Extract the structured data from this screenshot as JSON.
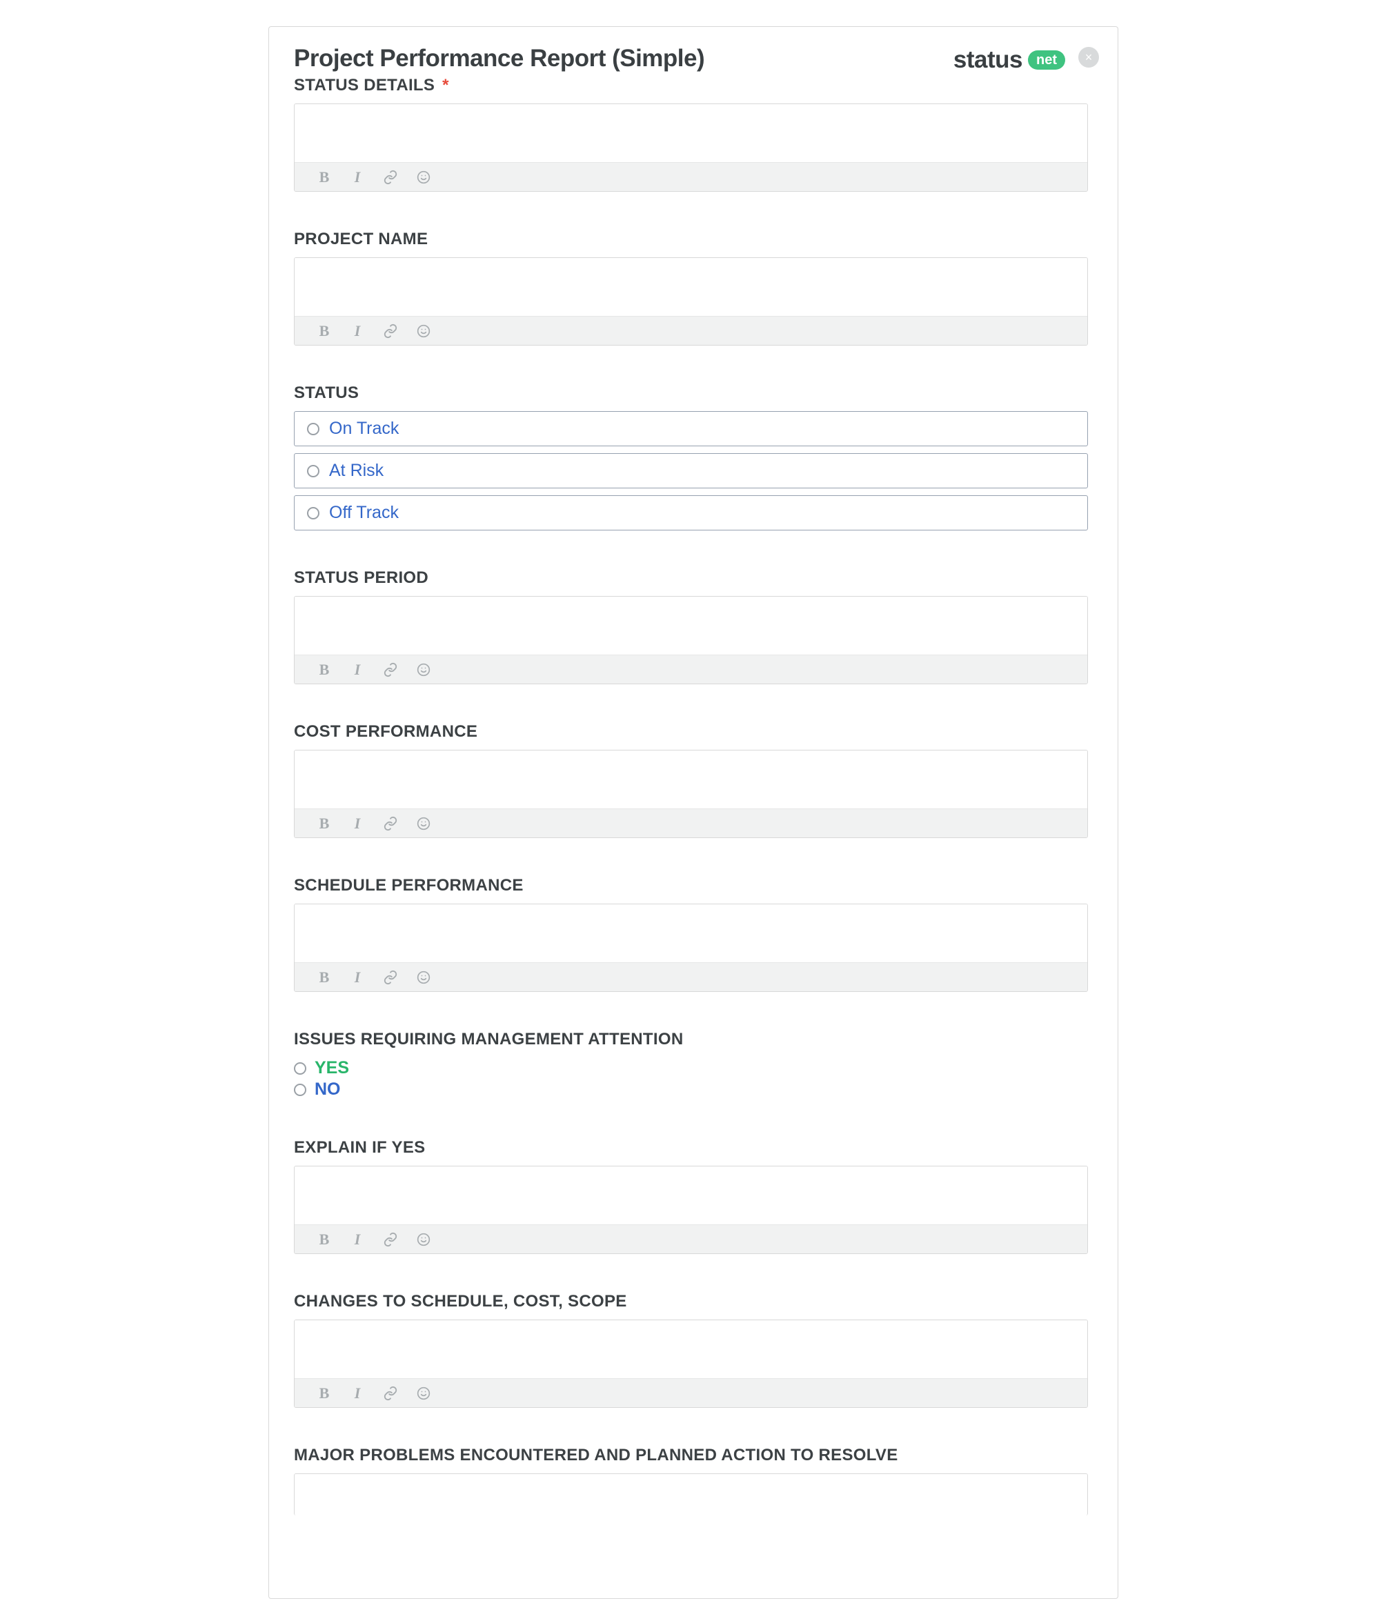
{
  "header": {
    "title": "Project Performance Report (Simple)"
  },
  "logo": {
    "text": "status",
    "badge": "net"
  },
  "close_glyph": "×",
  "toolbar": {
    "bold": "B",
    "italic": "I"
  },
  "status_options": [
    {
      "label": "On Track"
    },
    {
      "label": "At Risk"
    },
    {
      "label": "Off Track"
    }
  ],
  "issues_options": {
    "yes": "YES",
    "no": "NO"
  },
  "sections": {
    "status_details": {
      "label": "STATUS DETAILS",
      "required": true,
      "required_glyph": "*"
    },
    "project_name": {
      "label": "PROJECT NAME"
    },
    "status": {
      "label": "STATUS"
    },
    "status_period": {
      "label": "STATUS PERIOD"
    },
    "cost_performance": {
      "label": "COST PERFORMANCE"
    },
    "schedule_performance": {
      "label": "SCHEDULE PERFORMANCE"
    },
    "issues": {
      "label": "ISSUES REQUIRING MANAGEMENT ATTENTION"
    },
    "explain_if_yes": {
      "label": "EXPLAIN IF YES"
    },
    "changes": {
      "label": "CHANGES TO SCHEDULE, COST, SCOPE"
    },
    "major_problems": {
      "label": "MAJOR PROBLEMS ENCOUNTERED AND PLANNED ACTION TO RESOLVE"
    }
  }
}
